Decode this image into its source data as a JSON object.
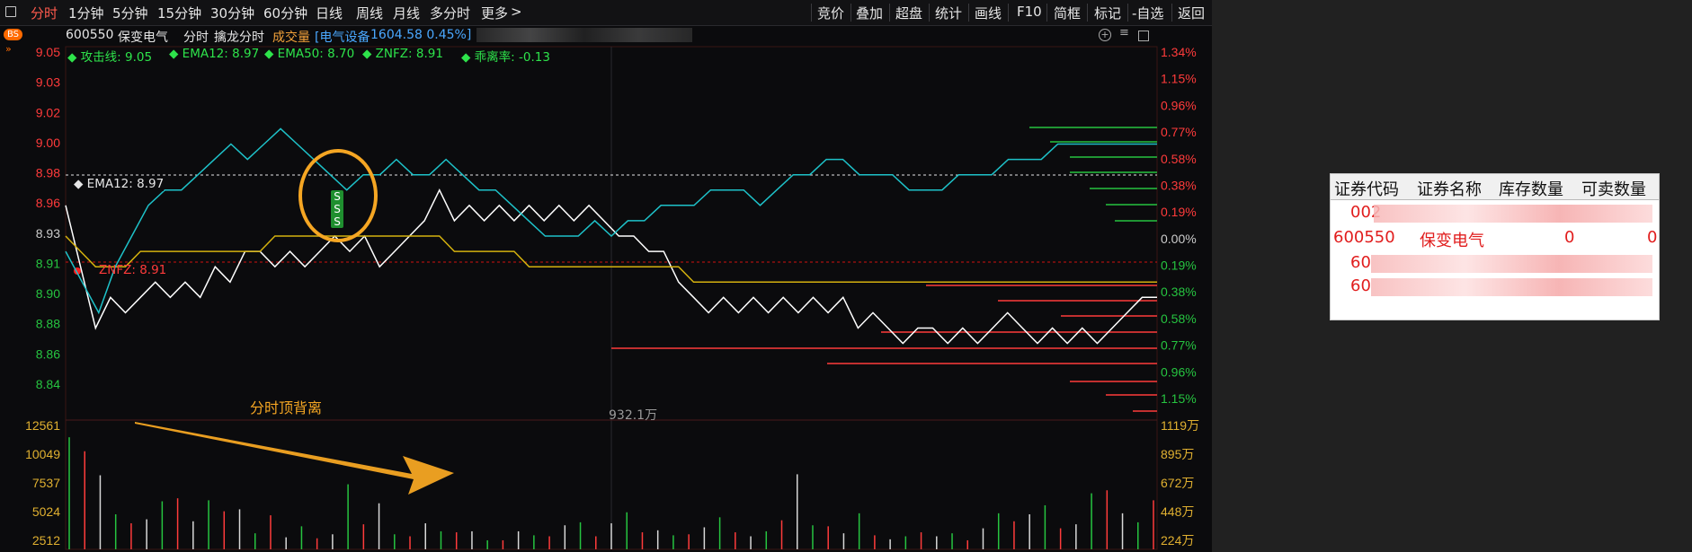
{
  "toolbar": {
    "tabs": [
      "分时",
      "1分钟",
      "5分钟",
      "15分钟",
      "30分钟",
      "60分钟",
      "日线",
      "周线",
      "月线",
      "多分时",
      "更多"
    ],
    "more_suffix": ">",
    "right": [
      "竞价",
      "叠加",
      "超盘",
      "统计",
      "画线",
      "F10",
      "简框",
      "标记",
      "-自选",
      "返回"
    ]
  },
  "info": {
    "code": "600550",
    "name": "保变电气",
    "mode": "分时",
    "sub_mode": "擒龙分时",
    "vol_label": "成交量",
    "sector": "[电气设备",
    "sector_value": "1604.58 0.45%]"
  },
  "indicators": {
    "attack_line": "◆ 攻击线: 9.05",
    "ema12": "◆ EMA12: 8.97",
    "ema50": "◆ EMA50: 8.70",
    "znfz": "◆ ZNFZ: 8.91",
    "rate": "◆ 乖离率: -0.13"
  },
  "bs_badge": "BS",
  "annotation": "分时顶背离",
  "ema12_marker": "◆ EMA12: 8.97",
  "znfz_marker": "ZNFZ: 8.91",
  "volume_peak_label": "932.1万",
  "sss_marks": [
    "S",
    "S",
    "S"
  ],
  "colors": {
    "up": "#ff3b3b",
    "down": "#26c440",
    "price": "#ffffff",
    "avg": "#d4b10e",
    "ema": "#1ec2c9",
    "highlight": "#f5a623"
  },
  "chart_data": {
    "type": "line",
    "price_axis": {
      "ticks": [
        "9.05",
        "9.03",
        "9.02",
        "9.00",
        "8.98",
        "8.96",
        "8.93",
        "8.91",
        "8.90",
        "8.88",
        "8.86",
        "8.84"
      ],
      "pct_ticks": [
        "1.34%",
        "1.15%",
        "0.96%",
        "0.77%",
        "0.58%",
        "0.38%",
        "0.19%",
        "0.00%",
        "0.19%",
        "0.38%",
        "0.58%",
        "0.77%",
        "0.96%",
        "1.15%"
      ],
      "ylim": [
        8.81,
        9.05
      ],
      "reference": 8.93
    },
    "volume_axis": {
      "left_ticks": [
        "12561",
        "10049",
        "7537",
        "5024",
        "2512"
      ],
      "right_ticks": [
        "1119万",
        "895万",
        "672万",
        "448万",
        "224万"
      ],
      "ylim": [
        0,
        12561
      ]
    },
    "series": [
      {
        "values": [
          8.95,
          8.91,
          8.87,
          8.89,
          8.88,
          8.89,
          8.9,
          8.89,
          8.9,
          8.89,
          8.91,
          8.9,
          8.92,
          8.92,
          8.91,
          8.92,
          8.91,
          8.92,
          8.93,
          8.92,
          8.93,
          8.91,
          8.92,
          8.93,
          8.94,
          8.96,
          8.94,
          8.95,
          8.94,
          8.95,
          8.94,
          8.95,
          8.94,
          8.95,
          8.94,
          8.95,
          8.94,
          8.93,
          8.93,
          8.92,
          8.92,
          8.9,
          8.89,
          8.88,
          8.89,
          8.88,
          8.89,
          8.88,
          8.89,
          8.88,
          8.89,
          8.88,
          8.89,
          8.87,
          8.88,
          8.87,
          8.86,
          8.87,
          8.87,
          8.86,
          8.87,
          8.86,
          8.87,
          8.88,
          8.87,
          8.86,
          8.87,
          8.86,
          8.87,
          8.86,
          8.87,
          8.88,
          8.89,
          8.89
        ]
      },
      {
        "values": [
          8.93,
          8.92,
          8.91,
          8.91,
          8.91,
          8.92,
          8.92,
          8.92,
          8.92,
          8.92,
          8.92,
          8.92,
          8.92,
          8.92,
          8.93,
          8.93,
          8.93,
          8.93,
          8.93,
          8.93,
          8.93,
          8.93,
          8.93,
          8.93,
          8.93,
          8.93,
          8.92,
          8.92,
          8.92,
          8.92,
          8.92,
          8.91,
          8.91,
          8.91,
          8.91,
          8.91,
          8.91,
          8.91,
          8.91,
          8.91,
          8.91,
          8.91,
          8.9,
          8.9,
          8.9,
          8.9,
          8.9,
          8.9,
          8.9,
          8.9,
          8.9,
          8.9,
          8.9,
          8.9,
          8.9,
          8.9,
          8.9,
          8.9,
          8.9,
          8.9,
          8.9,
          8.9,
          8.9,
          8.9,
          8.9,
          8.9,
          8.9,
          8.9,
          8.9,
          8.9,
          8.9,
          8.9,
          8.9,
          8.9
        ]
      },
      {
        "values": [
          8.92,
          8.9,
          8.88,
          8.91,
          8.93,
          8.95,
          8.96,
          8.96,
          8.97,
          8.98,
          8.99,
          8.98,
          8.99,
          9.0,
          8.99,
          8.98,
          8.97,
          8.96,
          8.97,
          8.97,
          8.98,
          8.97,
          8.97,
          8.98,
          8.97,
          8.96,
          8.96,
          8.95,
          8.94,
          8.93,
          8.93,
          8.93,
          8.94,
          8.93,
          8.94,
          8.94,
          8.95,
          8.95,
          8.95,
          8.96,
          8.96,
          8.96,
          8.95,
          8.96,
          8.97,
          8.97,
          8.98,
          8.98,
          8.97,
          8.97,
          8.97,
          8.96,
          8.96,
          8.96,
          8.97,
          8.97,
          8.97,
          8.98,
          8.98,
          8.98,
          8.99,
          8.99,
          8.99,
          8.99,
          8.99,
          8.99,
          8.99
        ]
      }
    ],
    "volume_bars": [
      11200,
      9800,
      7400,
      3500,
      2600,
      3000,
      4800,
      5100,
      2800,
      4900,
      3800,
      4000,
      1600,
      3400,
      1200,
      2300,
      1100,
      1500,
      6500,
      2500,
      4600,
      1500,
      1300,
      2600,
      1800,
      1700,
      1800,
      900,
      900,
      1800,
      1400,
      1300,
      2400,
      2700,
      1300,
      2600,
      3700,
      1700,
      1900,
      1400,
      1500,
      2200,
      3200,
      1700,
      1300,
      1800,
      2900,
      7500,
      2400,
      2300,
      1600,
      3600,
      1400,
      1000,
      1300,
      1700,
      1300,
      1600,
      900,
      2100,
      3600,
      2800,
      3500,
      4400,
      2100,
      2500,
      5600,
      5900,
      3600,
      2700,
      4900
    ]
  }
}
